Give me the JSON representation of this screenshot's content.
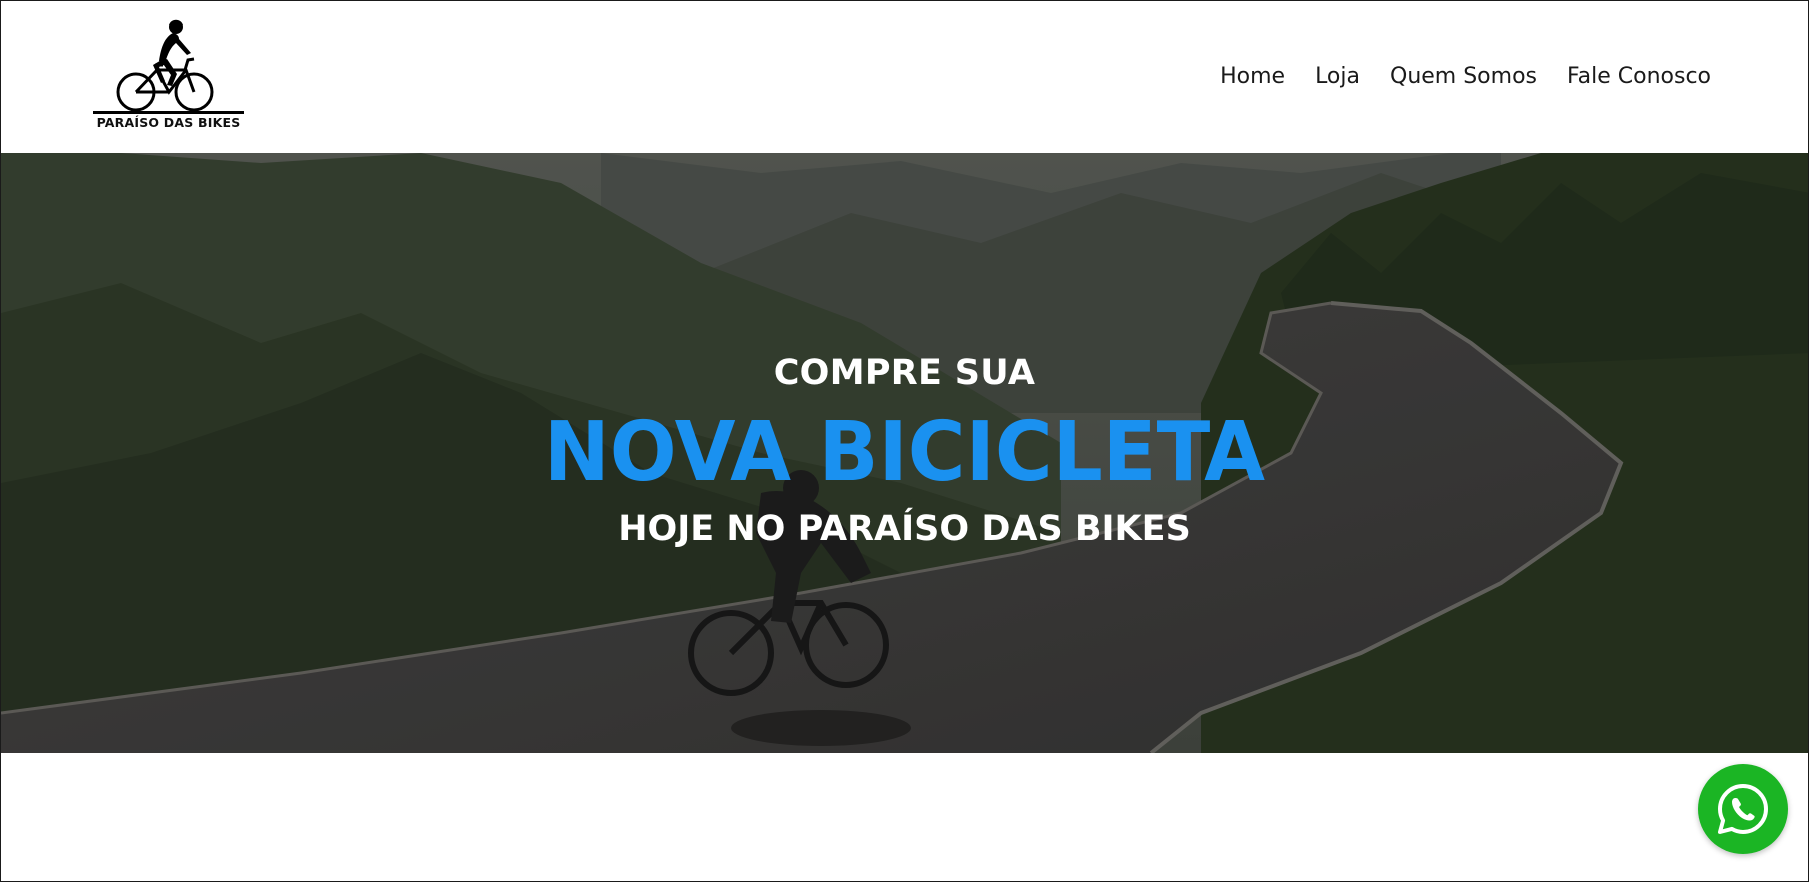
{
  "brand": {
    "name": "PARAÍSO DAS BIKES",
    "logo_icon": "cyclist-logo-icon"
  },
  "nav": {
    "items": [
      {
        "label": "Home"
      },
      {
        "label": "Loja"
      },
      {
        "label": "Quem Somos"
      },
      {
        "label": "Fale Conosco"
      }
    ]
  },
  "hero": {
    "line1": "COMPRE SUA",
    "line2": "NOVA BICICLETA",
    "line3": "HOJE NO PARAÍSO DAS BIKES",
    "accent_color": "#1a91f0",
    "background_image": "cyclist-on-mountain-road-photo"
  },
  "whatsapp": {
    "icon": "whatsapp-icon",
    "color": "#1bb524"
  }
}
